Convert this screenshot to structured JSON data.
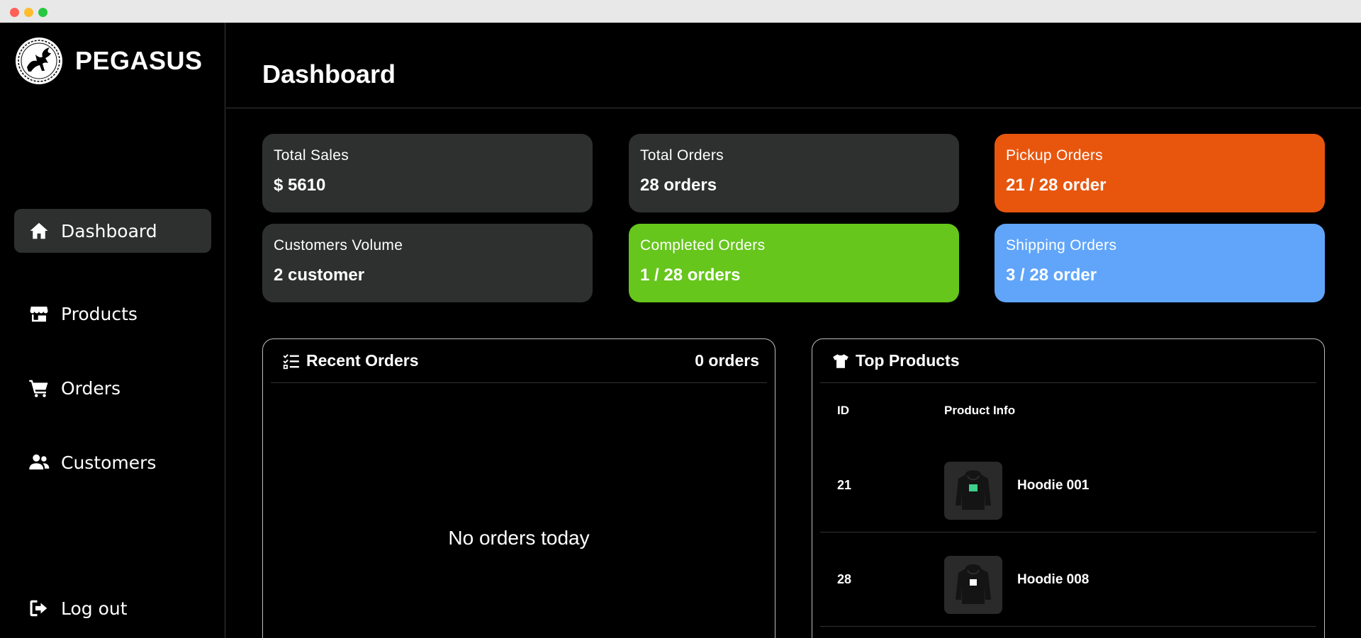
{
  "brand": {
    "name": "PEGASUS"
  },
  "nav": {
    "dashboard": "Dashboard",
    "products": "Products",
    "orders": "Orders",
    "customers": "Customers",
    "logout": "Log out"
  },
  "page": {
    "title": "Dashboard"
  },
  "stats": [
    {
      "label": "Total Sales",
      "value": "$ 5610"
    },
    {
      "label": "Total Orders",
      "value": "28 orders"
    },
    {
      "label": "Pickup Orders",
      "value": "21 / 28 order"
    },
    {
      "label": "Customers Volume",
      "value": "2 customer"
    },
    {
      "label": "Completed Orders",
      "value": "1 / 28 orders"
    },
    {
      "label": "Shipping Orders",
      "value": "3 / 28 order"
    }
  ],
  "recent_orders": {
    "title": "Recent Orders",
    "count": "0 orders",
    "empty": "No orders today"
  },
  "top_products": {
    "title": "Top Products",
    "columns": {
      "id": "ID",
      "info": "Product Info"
    },
    "rows": [
      {
        "id": "21",
        "name": "Hoodie 001",
        "print_color": "#3ecf8e"
      },
      {
        "id": "28",
        "name": "Hoodie 008",
        "print_color": "#ffffff"
      }
    ]
  },
  "colors": {
    "card_dark": "#2e2f2f",
    "orange": "#e8560e",
    "green": "#66c61c",
    "blue": "#60a5fa"
  }
}
